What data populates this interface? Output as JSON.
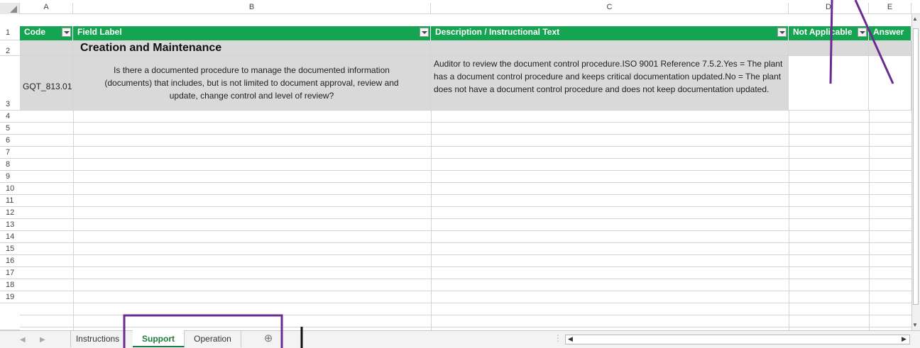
{
  "columns": {
    "corner": "",
    "a": "A",
    "b": "B",
    "c": "C",
    "d": "D",
    "e": "E"
  },
  "headers": {
    "code": "Code",
    "field_label": "Field Label",
    "description": "Description / Instructional Text",
    "not_applicable": "Not Applicable",
    "answer": "Answer"
  },
  "rows": {
    "numbers": [
      "1",
      "2",
      "3",
      "4",
      "5",
      "6",
      "7",
      "8",
      "9",
      "10",
      "11",
      "12",
      "13",
      "14",
      "15",
      "16",
      "17",
      "18",
      "19"
    ]
  },
  "section": {
    "title": "Creation and Maintenance"
  },
  "record": {
    "code": "GQT_813.01",
    "field_label": "Is there a documented procedure to manage the documented information (documents) that includes, but is not limited to document approval, review and update, change control and level of review?",
    "description": "Auditor to review the document control procedure.ISO 9001 Reference 7.5.2.Yes = The plant has a document control procedure and keeps critical documentation updated.No = The plant does not have a document control procedure and does not keep documentation updated."
  },
  "sheet_tabs": {
    "instructions": "Instructions",
    "support": "Support",
    "operation": "Operation",
    "add": "⊕"
  },
  "nav": {
    "prev": "◀",
    "next": "▶",
    "more": "⋮",
    "scroll_left": "◀",
    "scroll_right": "▶",
    "scroll_up": "▲",
    "scroll_down": "▼"
  },
  "colors": {
    "header_green": "#15a552",
    "annotation_purple": "#6b2c91",
    "active_tab": "#1e7a3c"
  }
}
